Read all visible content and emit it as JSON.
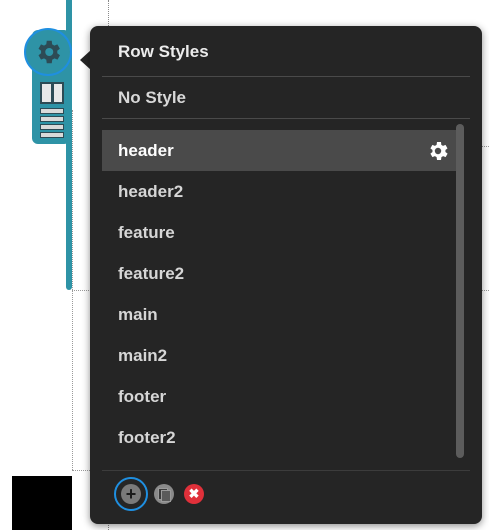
{
  "popup": {
    "title": "Row Styles",
    "no_style_label": "No Style",
    "styles": [
      {
        "label": "header",
        "selected": true
      },
      {
        "label": "header2",
        "selected": false
      },
      {
        "label": "feature",
        "selected": false
      },
      {
        "label": "feature2",
        "selected": false
      },
      {
        "label": "main",
        "selected": false
      },
      {
        "label": "main2",
        "selected": false
      },
      {
        "label": "footer",
        "selected": false
      },
      {
        "label": "footer2",
        "selected": false
      }
    ],
    "footer_buttons": {
      "add_glyph": "+",
      "delete_glyph": "✖"
    }
  },
  "toolbar": {
    "icons": [
      "gear-icon",
      "column-layout-icon",
      "rows-icon"
    ]
  },
  "colors": {
    "accent": "#2e93a6",
    "focus": "#1f8fe0",
    "popup_bg": "#252525",
    "selected_row": "#4a4a4a",
    "delete": "#e0303a"
  }
}
